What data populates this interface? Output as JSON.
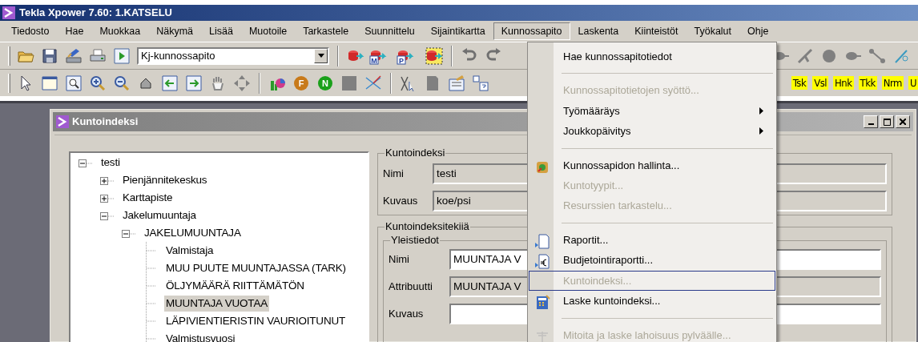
{
  "window": {
    "title": "Tekla Xpower 7.60: 1.KATSELU"
  },
  "menu_bar": [
    {
      "label": "Tiedosto",
      "selected": false
    },
    {
      "label": "Hae",
      "selected": false
    },
    {
      "label": "Muokkaa",
      "selected": false
    },
    {
      "label": "Näkymä",
      "selected": false
    },
    {
      "label": "Lisää",
      "selected": false
    },
    {
      "label": "Muotoile",
      "selected": false
    },
    {
      "label": "Tarkastele",
      "selected": false
    },
    {
      "label": "Suunnittelu",
      "selected": false
    },
    {
      "label": "Sijaintikartta",
      "selected": false
    },
    {
      "label": "Kunnossapito",
      "selected": true
    },
    {
      "label": "Laskenta",
      "selected": false
    },
    {
      "label": "Kiinteistöt",
      "selected": false
    },
    {
      "label": "Työkalut",
      "selected": false
    },
    {
      "label": "Ohje",
      "selected": false
    }
  ],
  "toolbar_1": {
    "combo": {
      "value": "Kj-kunnossapito"
    },
    "badges": [
      "M",
      "P"
    ]
  },
  "toolbar_2": {
    "badges": [
      "F",
      "N"
    ],
    "layer_buttons": [
      "Tsk",
      "Vsl",
      "Hnk",
      "Tkk",
      "Nrm",
      "U"
    ]
  },
  "child_window": {
    "title": "Kuntoindeksi"
  },
  "tree": [
    {
      "label": "testi",
      "expanded": true,
      "selected": false,
      "children": [
        {
          "label": "Pienjännitekeskus",
          "expanded": false,
          "selected": false
        },
        {
          "label": "Karttapiste",
          "expanded": false,
          "selected": false
        },
        {
          "label": "Jakelumuuntaja",
          "expanded": true,
          "selected": false,
          "children": [
            {
              "label": "JAKELUMUUNTAJA",
              "expanded": true,
              "selected": false,
              "children": [
                {
                  "label": "Valmistaja",
                  "selected": false
                },
                {
                  "label": "MUU PUUTE MUUNTAJASSA (TARK)",
                  "selected": false
                },
                {
                  "label": "ÖLJYMÄÄRÄ RIITTÄMÄTÖN",
                  "selected": false
                },
                {
                  "label": "MUUNTAJA VUOTAA",
                  "selected": true
                },
                {
                  "label": "LÄPIVIENTIERISTIN VAURIOITUNUT",
                  "selected": false
                },
                {
                  "label": "Valmistusvuosi",
                  "selected": false
                }
              ]
            }
          ]
        }
      ]
    }
  ],
  "kuntoindeksi": {
    "legend": "Kuntoindeksi",
    "fields": [
      {
        "label": "Nimi",
        "value": "testi",
        "readonly": true
      },
      {
        "label": "Kuvaus",
        "value": "koe/psi",
        "readonly": true
      }
    ]
  },
  "tekijat": {
    "legend": "Kuntoindeksitekiiä",
    "group": {
      "legend": "Yleistiedot",
      "fields": [
        {
          "label": "Nimi",
          "value": "MUUNTAJA V",
          "readonly": false
        },
        {
          "label": "Attribuutti",
          "value": "MUUNTAJA V",
          "readonly": true
        },
        {
          "label": "Kuvaus",
          "readonly": false
        }
      ]
    }
  },
  "dropdown": [
    {
      "kind": "item",
      "label": "Hae kunnossapitotiedot",
      "disabled": false,
      "submenu": false,
      "selected": false
    },
    {
      "kind": "separator"
    },
    {
      "kind": "item",
      "label": "Kunnossapitotietojen syöttö...",
      "disabled": true,
      "submenu": false,
      "selected": false
    },
    {
      "kind": "item",
      "label": "Työmääräys",
      "disabled": false,
      "submenu": true,
      "selected": false
    },
    {
      "kind": "item",
      "label": "Joukkopäivitys",
      "disabled": false,
      "submenu": true,
      "selected": false
    },
    {
      "kind": "separator"
    },
    {
      "kind": "item",
      "label": "Kunnossapidon hallinta...",
      "disabled": false,
      "submenu": false,
      "selected": false
    },
    {
      "kind": "item",
      "label": "Kuntotyypit...",
      "disabled": true,
      "submenu": false,
      "selected": false
    },
    {
      "kind": "item",
      "label": "Resurssien tarkastelu...",
      "disabled": true,
      "submenu": false,
      "selected": false
    },
    {
      "kind": "separator"
    },
    {
      "kind": "item",
      "label": "Raportit...",
      "disabled": false,
      "submenu": false,
      "selected": false
    },
    {
      "kind": "item",
      "label": "Budjetointiraportti...",
      "disabled": false,
      "submenu": false,
      "selected": false
    },
    {
      "kind": "item",
      "label": "Kuntoindeksi...",
      "disabled": true,
      "submenu": false,
      "selected": true
    },
    {
      "kind": "item",
      "label": "Laske kuntoindeksi...",
      "disabled": false,
      "submenu": false,
      "selected": false
    },
    {
      "kind": "separator"
    },
    {
      "kind": "item",
      "label": "Mitoita ja laske lahoisuus pylväälle...",
      "disabled": true,
      "submenu": false,
      "selected": false
    }
  ]
}
